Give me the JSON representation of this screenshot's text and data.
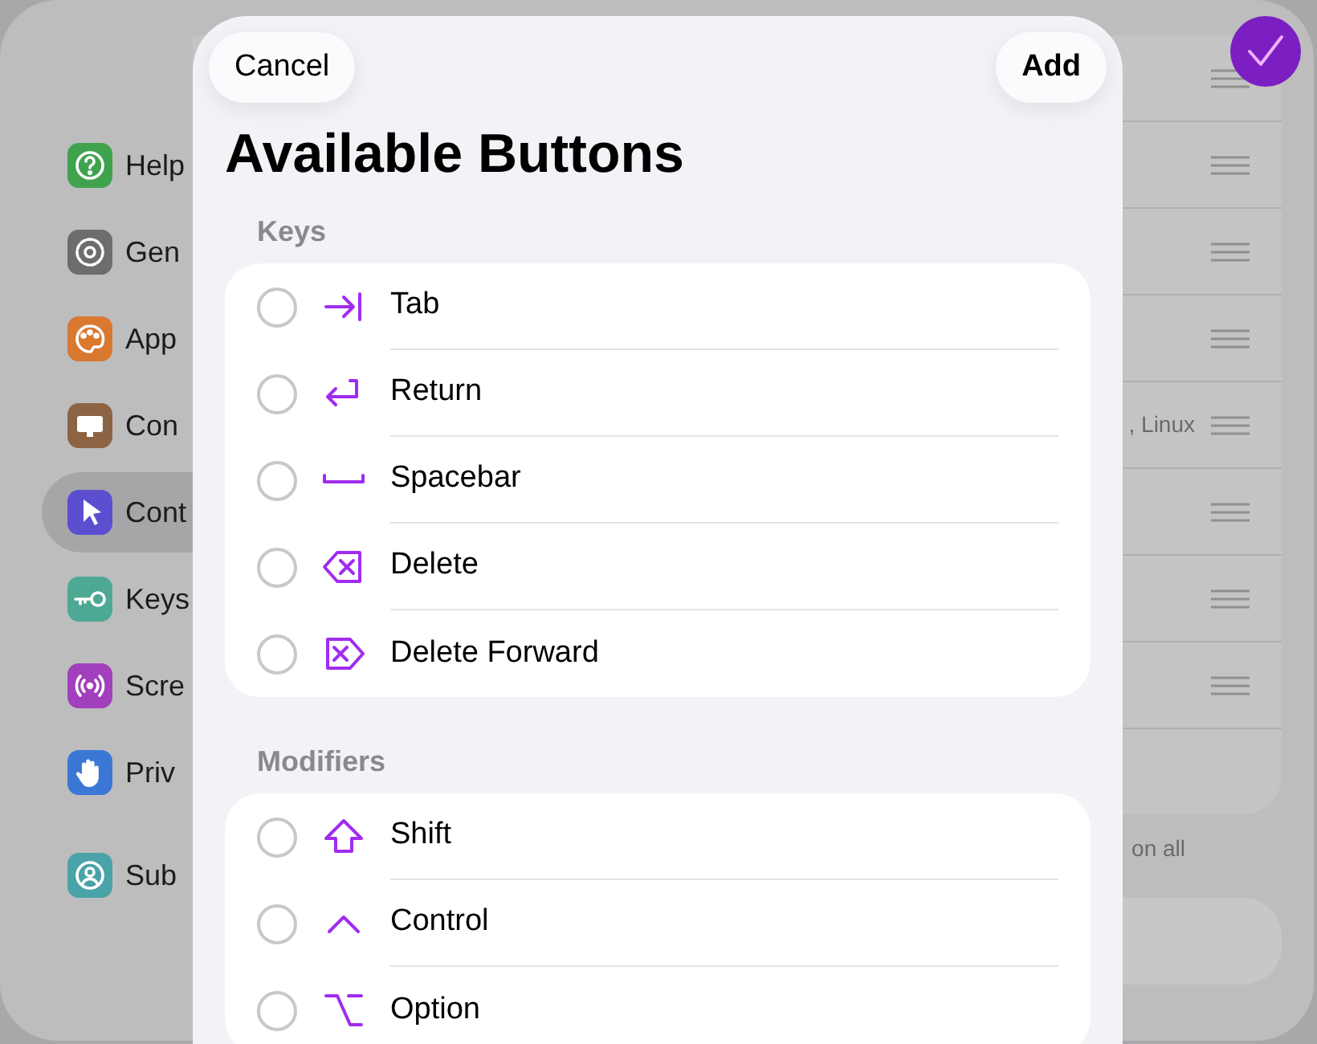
{
  "sidebar": {
    "items": [
      {
        "label": "Help",
        "kind": "help",
        "color": "#3fa34d",
        "selected": false
      },
      {
        "label": "Gen",
        "kind": "gear",
        "color": "#6d6d70",
        "selected": false
      },
      {
        "label": "App",
        "kind": "palette",
        "color": "#d9782f",
        "selected": false
      },
      {
        "label": "Con",
        "kind": "monitor",
        "color": "#8c6444",
        "selected": false
      },
      {
        "label": "Cont",
        "kind": "pointer",
        "color": "#5b4fd0",
        "selected": true
      },
      {
        "label": "Keys",
        "kind": "key",
        "color": "#4ea994",
        "selected": false
      },
      {
        "label": "Scre",
        "kind": "broadcast",
        "color": "#a23fbd",
        "selected": false
      },
      {
        "label": "Priv",
        "kind": "hand",
        "color": "#3b78d6",
        "selected": false
      },
      {
        "label": "Sub",
        "kind": "person",
        "color": "#4aa3a8",
        "selected": false
      }
    ]
  },
  "background_list": {
    "detail": ", Linux",
    "footer": "on all"
  },
  "modal": {
    "cancel": "Cancel",
    "add": "Add",
    "title": "Available Buttons",
    "sections": [
      {
        "header": "Keys",
        "items": [
          {
            "label": "Tab",
            "kind": "tab",
            "selected": false
          },
          {
            "label": "Return",
            "kind": "return",
            "selected": false
          },
          {
            "label": "Spacebar",
            "kind": "space",
            "selected": false
          },
          {
            "label": "Delete",
            "kind": "delete",
            "selected": false
          },
          {
            "label": "Delete Forward",
            "kind": "delete_forward",
            "selected": false
          }
        ]
      },
      {
        "header": "Modifiers",
        "items": [
          {
            "label": "Shift",
            "kind": "shift",
            "selected": false
          },
          {
            "label": "Control",
            "kind": "control",
            "selected": false
          },
          {
            "label": "Option",
            "kind": "option",
            "selected": false
          }
        ]
      }
    ]
  }
}
